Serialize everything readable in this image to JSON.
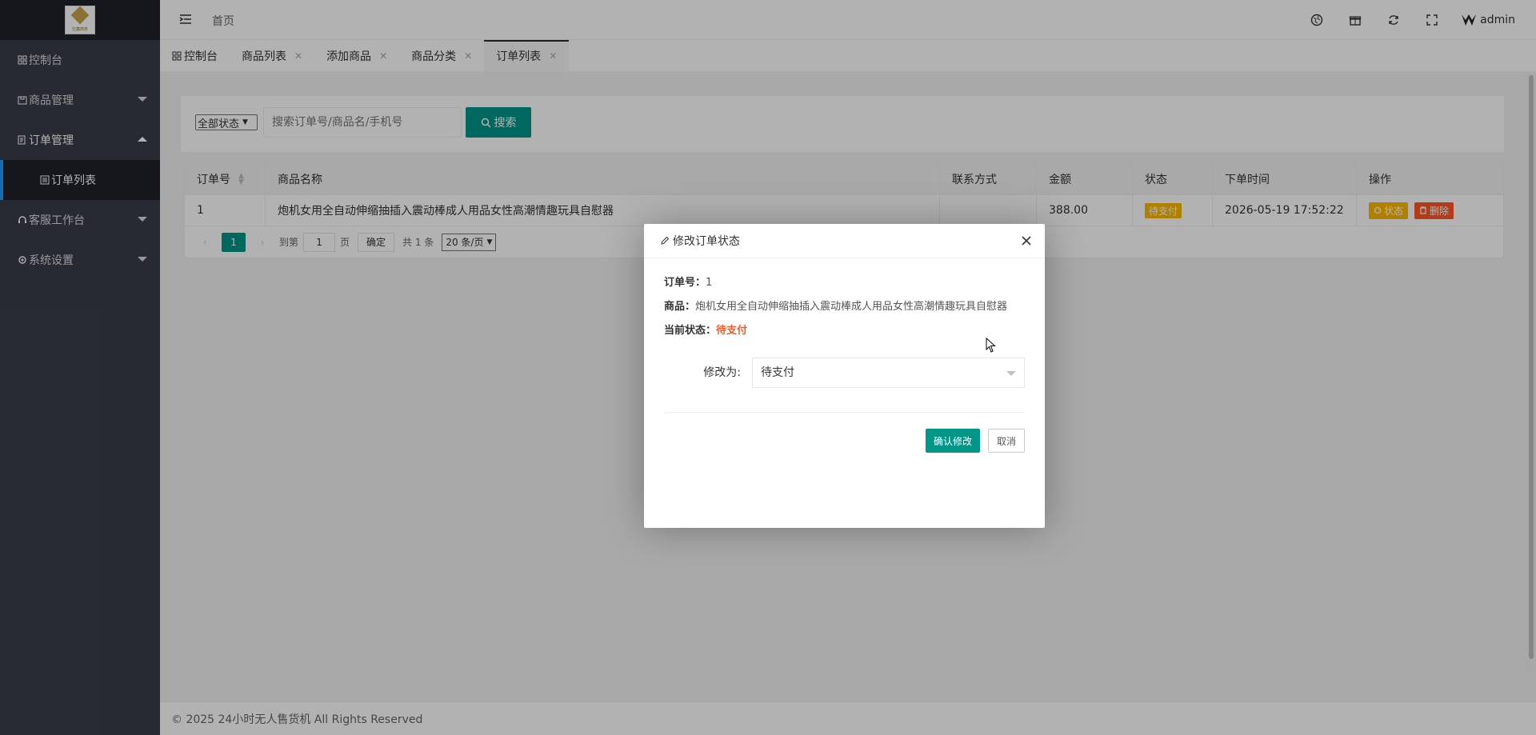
{
  "sidebar": {
    "logo_text": "亿鑫商务",
    "items": [
      {
        "label": "控制台",
        "icon": "dashboard-icon"
      },
      {
        "label": "商品管理",
        "icon": "box-icon"
      },
      {
        "label": "订单管理",
        "icon": "order-icon"
      },
      {
        "label": "订单列表",
        "icon": "list-icon"
      },
      {
        "label": "客服工作台",
        "icon": "headset-icon"
      },
      {
        "label": "系统设置",
        "icon": "gear-icon"
      }
    ]
  },
  "header": {
    "home": "首页",
    "user": "admin"
  },
  "tabs": [
    {
      "label": "控制台"
    },
    {
      "label": "商品列表"
    },
    {
      "label": "添加商品"
    },
    {
      "label": "商品分类"
    },
    {
      "label": "订单列表"
    }
  ],
  "toolbar": {
    "status_select": "全部状态",
    "search_placeholder": "搜索订单号/商品名/手机号",
    "search_button": "搜索"
  },
  "table": {
    "columns": [
      "订单号",
      "商品名称",
      "联系方式",
      "金额",
      "状态",
      "下单时间",
      "操作"
    ],
    "rows": [
      {
        "id": "1",
        "product": "炮机女用全自动伸缩抽插入震动棒成人用品女性高潮情趣玩具自慰器",
        "contact": "",
        "amount": "388.00",
        "status": "待支付",
        "time": "2026-05-19 17:52:22",
        "action_status": "状态",
        "action_delete": "删除"
      }
    ]
  },
  "pager": {
    "current": "1",
    "goto_label": "到第",
    "page_input": "1",
    "page_unit": "页",
    "confirm": "确定",
    "total": "共 1 条",
    "limit": "20 条/页"
  },
  "modal": {
    "title": "修改订单状态",
    "order_label": "订单号：",
    "order_value": "1",
    "product_label": "商品：",
    "product_value": "炮机女用全自动伸缩抽插入震动棒成人用品女性高潮情趣玩具自慰器",
    "current_label": "当前状态：",
    "current_value": "待支付",
    "change_label": "修改为:",
    "change_value": "待支付",
    "confirm": "确认修改",
    "cancel": "取消"
  },
  "footer": "© 2025 24小时无人售货机 All Rights Reserved",
  "colors": {
    "sidebar_bg": "#393d49",
    "primary": "#009688",
    "warn": "#ffb800",
    "danger": "#ff5722"
  }
}
